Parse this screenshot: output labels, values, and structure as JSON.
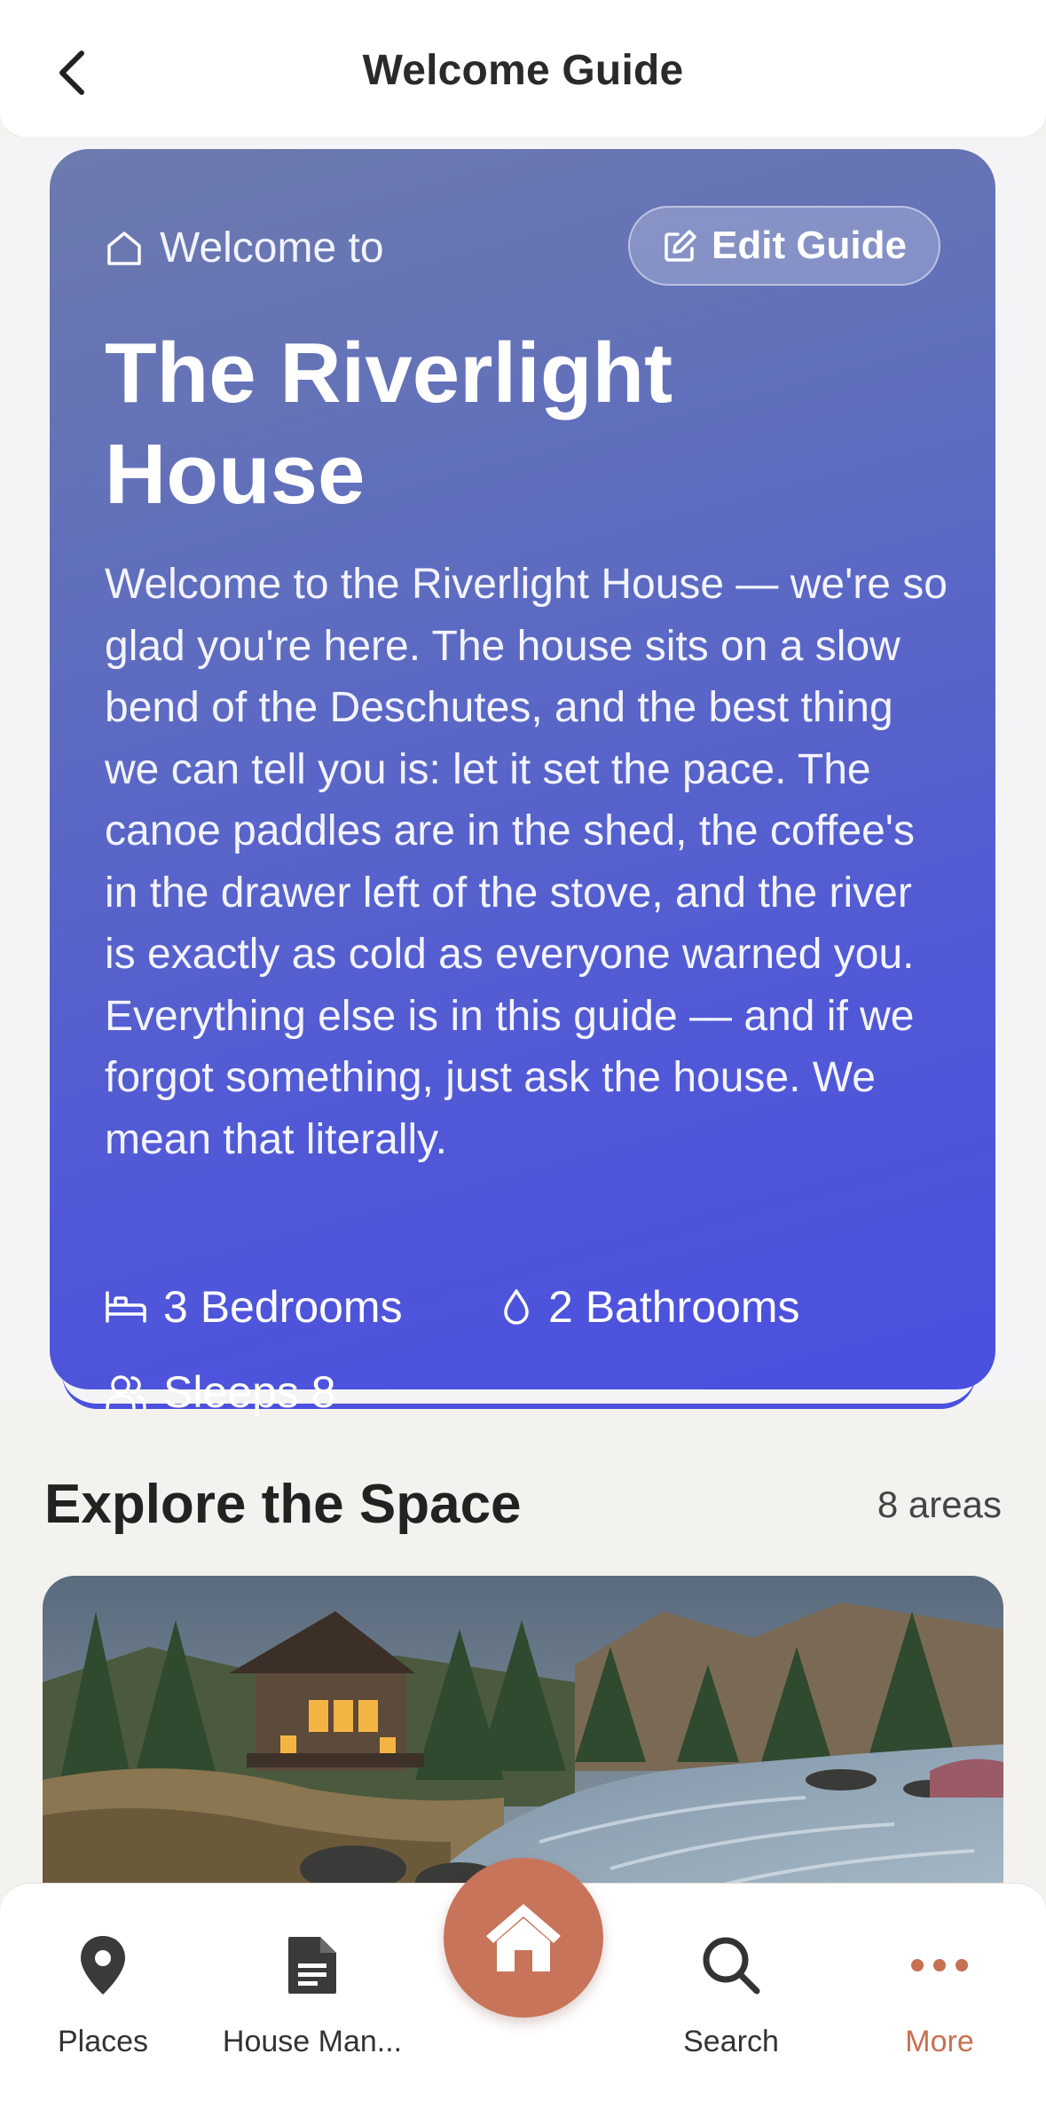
{
  "header": {
    "title": "Welcome Guide"
  },
  "hero": {
    "welcome_label": "Welcome to",
    "edit_button": "Edit Guide",
    "house_name": "The Riverlight House",
    "intro": "Welcome to the Riverlight House — we're so glad you're here. The house sits on a slow bend of the Deschutes, and the best thing we can tell you is: let it set the pace. The canoe paddles are in the shed, the coffee's in the drawer left of the stove, and the river is exactly as cold as everyone warned you. Everything else is in this guide — and if we forgot something, just ask the house. We mean that literally.",
    "stats": {
      "bedrooms": "3 Bedrooms",
      "bathrooms": "2 Bathrooms",
      "sleeps": "Sleeps 8"
    }
  },
  "explore": {
    "title": "Explore the Space",
    "count": "8 areas"
  },
  "bottom_nav": {
    "places": "Places",
    "manual": "House Man...",
    "search": "Search",
    "more": "More"
  },
  "colors": {
    "accent": "#c7745a",
    "hero_start": "#6d7aad",
    "hero_end": "#4a4fe0"
  }
}
